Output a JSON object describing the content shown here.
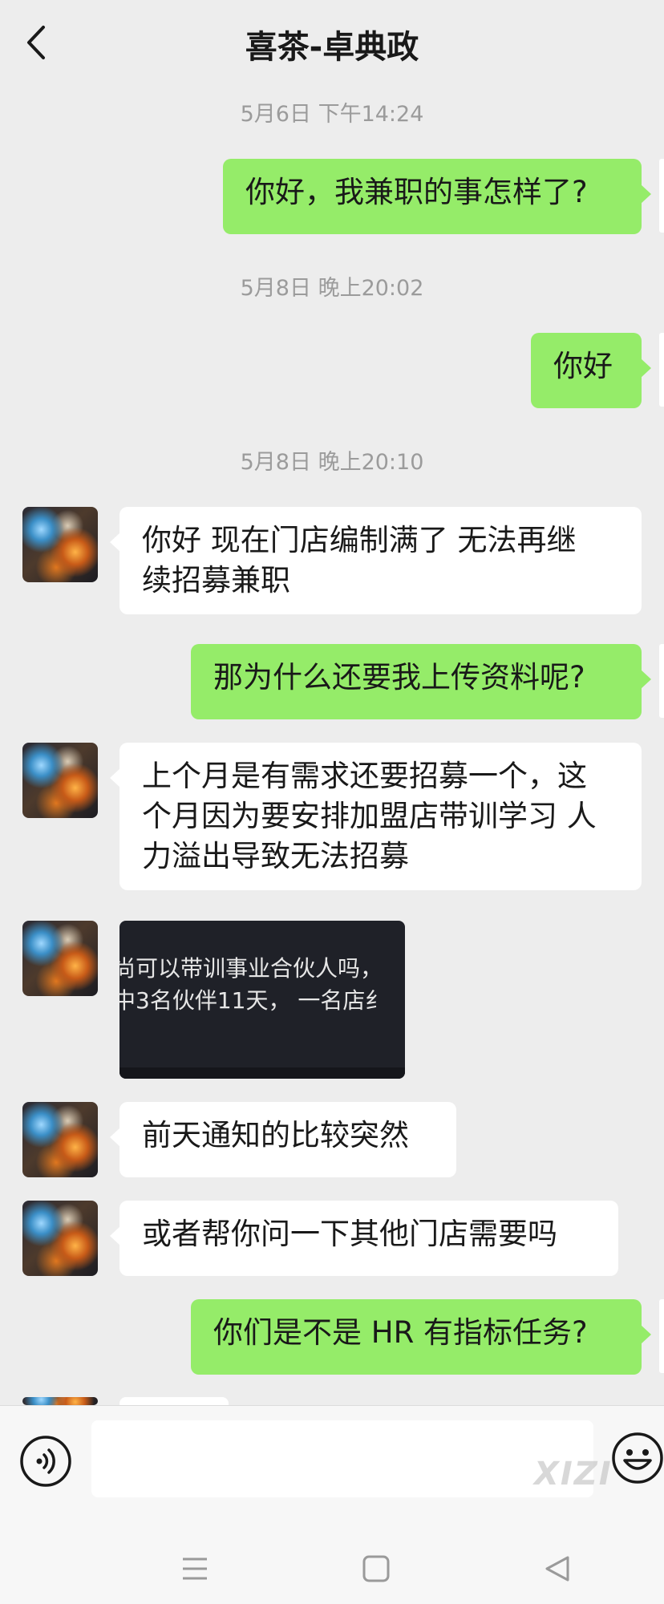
{
  "header": {
    "title": "喜茶-卓典政",
    "back_icon": "chevron-left-icon"
  },
  "messages": [
    {
      "type": "timestamp",
      "text": "5月6日 下午14:24"
    },
    {
      "type": "text",
      "sender": "me",
      "text": "你好，我兼职的事怎样了?"
    },
    {
      "type": "timestamp",
      "text": "5月8日 晚上20:02"
    },
    {
      "type": "text",
      "sender": "me",
      "text": "你好"
    },
    {
      "type": "timestamp",
      "text": "5月8日 晚上20:10"
    },
    {
      "type": "text",
      "sender": "other",
      "lines": [
        "你好 现在门店编制满了 无法再继",
        "续招募兼职"
      ]
    },
    {
      "type": "text",
      "sender": "me",
      "text": "那为什么还要我上传资料呢?"
    },
    {
      "type": "text",
      "sender": "other",
      "lines": [
        "上个月是有需求还要招募一个，这",
        "个月因为要安排加盟店带训学习 人",
        "力溢出导致无法招募"
      ]
    },
    {
      "type": "image",
      "sender": "other",
      "lines": [
        "尚可以带训事业合伙人吗，",
        "中3名伙伴11天， 一名店纟"
      ]
    },
    {
      "type": "text",
      "sender": "other",
      "text": "前天通知的比较突然"
    },
    {
      "type": "text",
      "sender": "other",
      "text": "或者帮你问一下其他门店需要吗"
    },
    {
      "type": "text",
      "sender": "me",
      "text": "你们是不是 HR 有指标任务?"
    }
  ],
  "input_bar": {
    "voice_icon": "voice-icon",
    "emoji_icon": "emoji-icon",
    "watermark": "XIZI"
  },
  "nav_bar": {
    "menu_icon": "menu-icon",
    "home_icon": "home-icon",
    "back_icon": "back-triangle-icon"
  },
  "colors": {
    "background": "#ededed",
    "self_bubble": "#95ec69",
    "other_bubble": "#ffffff",
    "timestamp": "#9b9b9b"
  }
}
